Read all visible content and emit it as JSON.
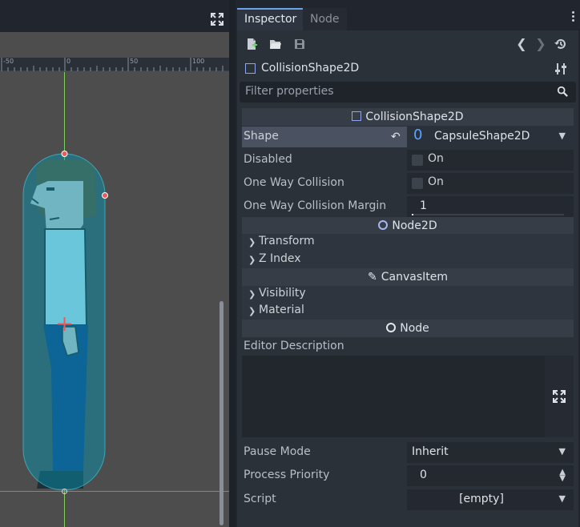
{
  "viewport": {
    "ruler_labels": [
      "-50",
      "0",
      "50",
      "100"
    ],
    "expand_icon": "expand-icon"
  },
  "tabs": {
    "inspector": "Inspector",
    "node": "Node"
  },
  "toolbar": {
    "icons": [
      "new-resource-icon",
      "open-folder-icon",
      "save-icon",
      "back-icon",
      "forward-icon",
      "history-icon",
      "object-settings-icon"
    ]
  },
  "object": {
    "name": "CollisionShape2D"
  },
  "filter": {
    "placeholder": "Filter properties"
  },
  "sections": {
    "collision_shape": "CollisionShape2D",
    "node2d": "Node2D",
    "canvas_item": "CanvasItem",
    "node": "Node"
  },
  "props": {
    "shape_label": "Shape",
    "shape_value": "CapsuleShape2D",
    "shape_icon_glyph": "0",
    "disabled_label": "Disabled",
    "disabled_value": "On",
    "one_way_label": "One Way Collision",
    "one_way_value": "On",
    "margin_label": "One Way Collision Margin",
    "margin_value": "1",
    "transform": "Transform",
    "z_index": "Z Index",
    "visibility": "Visibility",
    "material": "Material",
    "editor_description": "Editor Description",
    "pause_mode_label": "Pause Mode",
    "pause_mode_value": "Inherit",
    "process_priority_label": "Process Priority",
    "process_priority_value": "0",
    "script_label": "Script",
    "script_value": "[empty]"
  },
  "colors": {
    "accent": "#6aa2e7",
    "capsule": "#1e6e80",
    "handle": "#e85c5c"
  }
}
